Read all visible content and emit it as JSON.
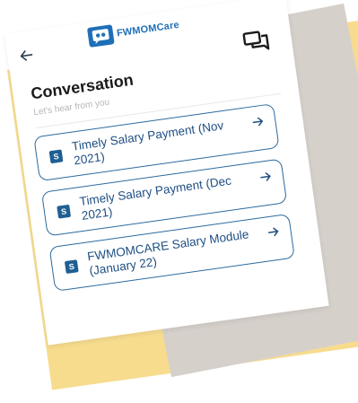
{
  "app": {
    "brand": "FWMOMCare"
  },
  "header": {
    "back_label": "←"
  },
  "page": {
    "title": "Conversation",
    "subtitle": "Let's hear from you"
  },
  "list": {
    "items": [
      {
        "badge": "S",
        "label": "Timely Salary Payment (Nov 2021)"
      },
      {
        "badge": "S",
        "label": "Timely Salary Payment (Dec 2021)"
      },
      {
        "badge": "S",
        "label": "FWMOMCARE Salary Module (January 22)"
      }
    ]
  },
  "icons": {
    "back": "arrow-left-icon",
    "chat": "chat-bubbles-icon",
    "arrow": "arrow-right-icon",
    "logo": "chat-logo-icon"
  },
  "colors": {
    "accent": "#1f6fb8",
    "card_border": "#2b6a9e",
    "yellow_bg": "#f7dc8e",
    "gray_bg": "#d6d0cb"
  }
}
